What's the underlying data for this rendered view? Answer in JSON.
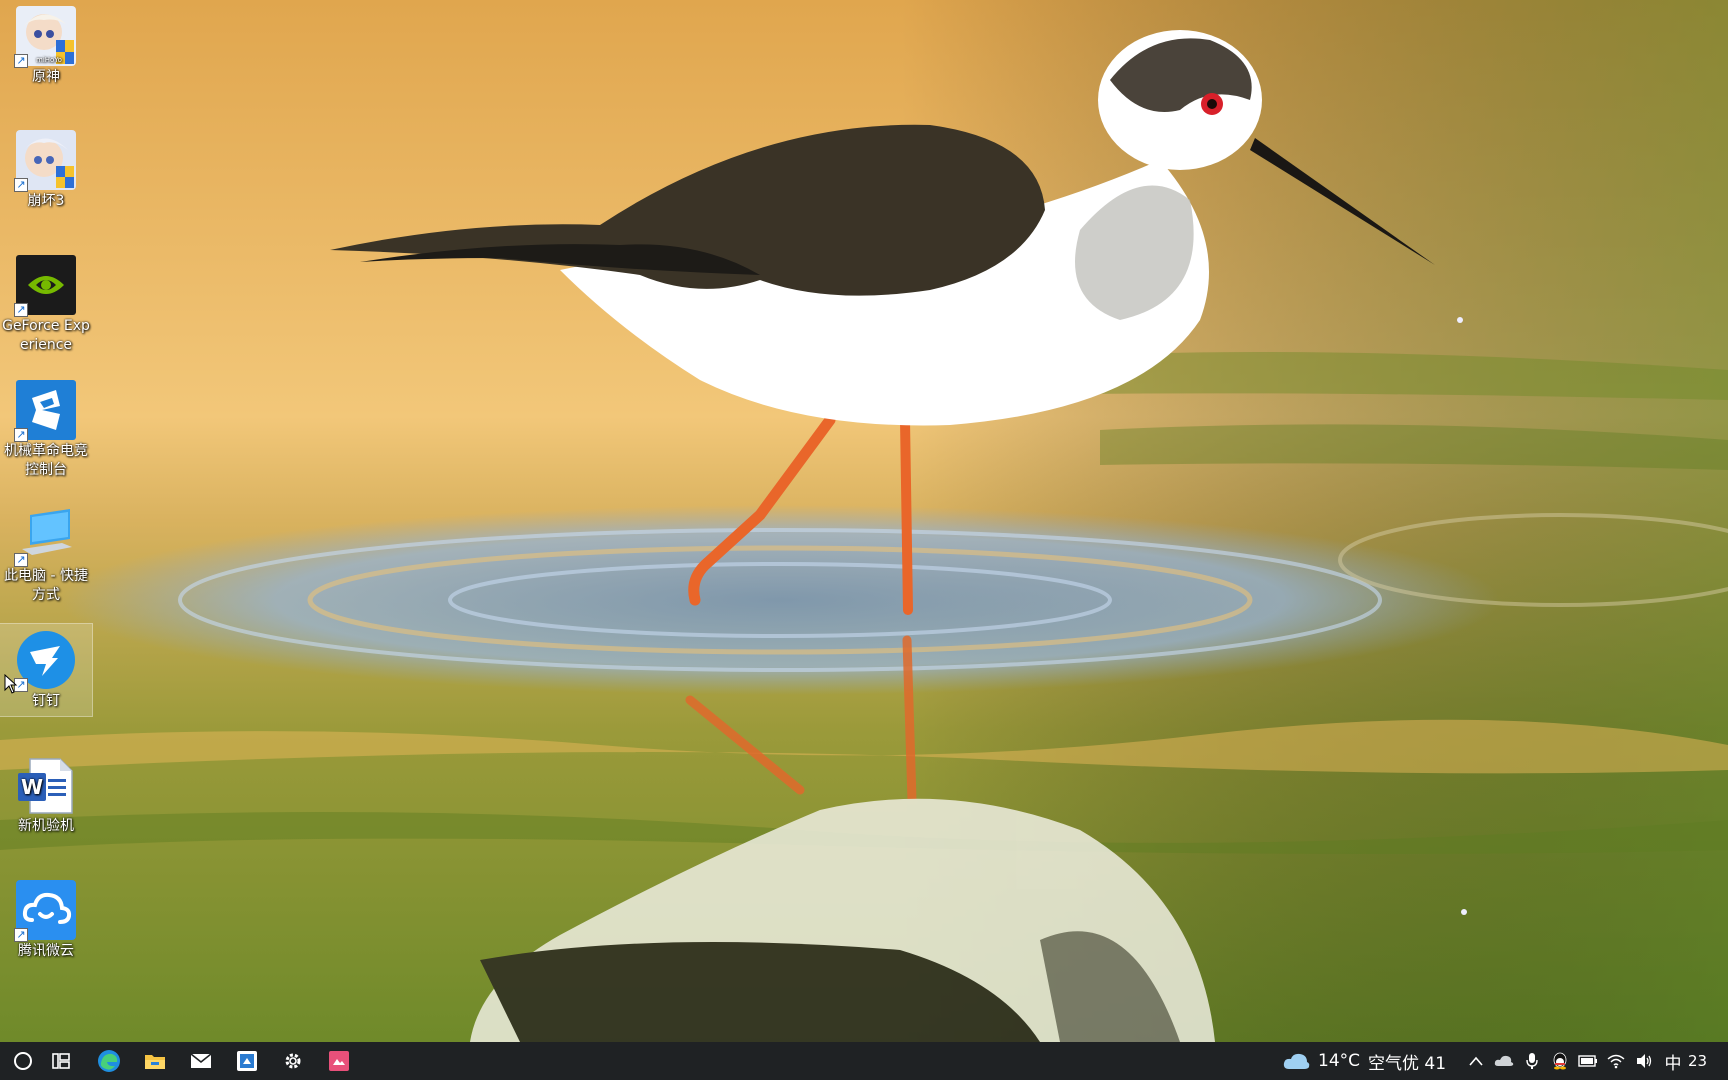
{
  "desktop": {
    "icons": [
      {
        "label": "原神",
        "icon": "genshin-app-icon"
      },
      {
        "label": "崩坏3",
        "icon": "honkai3-app-icon"
      },
      {
        "label": "GeForce Experience",
        "icon": "nvidia-geforce-icon"
      },
      {
        "label": "机械革命电竞控制台",
        "icon": "mechrevo-control-icon"
      },
      {
        "label": "此电脑 - 快捷方式",
        "icon": "this-pc-icon"
      },
      {
        "label": "钉钉",
        "icon": "dingtalk-icon"
      },
      {
        "label": "新机验机",
        "icon": "word-document-icon"
      },
      {
        "label": "腾讯微云",
        "icon": "weiyun-cloud-icon"
      }
    ],
    "selected_icon": "钉钉"
  },
  "taskbar": {
    "pinned": [
      "search-circle-icon",
      "task-view-icon",
      "edge-browser-icon",
      "file-explorer-icon",
      "mail-icon",
      "app-window-icon",
      "settings-gear-icon",
      "red-app-icon"
    ],
    "weather": {
      "temp": "14°C",
      "air_quality": "空气优 41",
      "icon": "cloud-icon"
    },
    "tray": [
      "chevron-up-icon",
      "onedrive-icon",
      "microphone-icon",
      "qq-penguin-icon",
      "battery-icon",
      "wifi-icon",
      "volume-icon"
    ],
    "ime": "中",
    "clock_partial": "23"
  },
  "colors": {
    "taskbar_bg": "#1f2224",
    "accent": "#1e90e6"
  }
}
